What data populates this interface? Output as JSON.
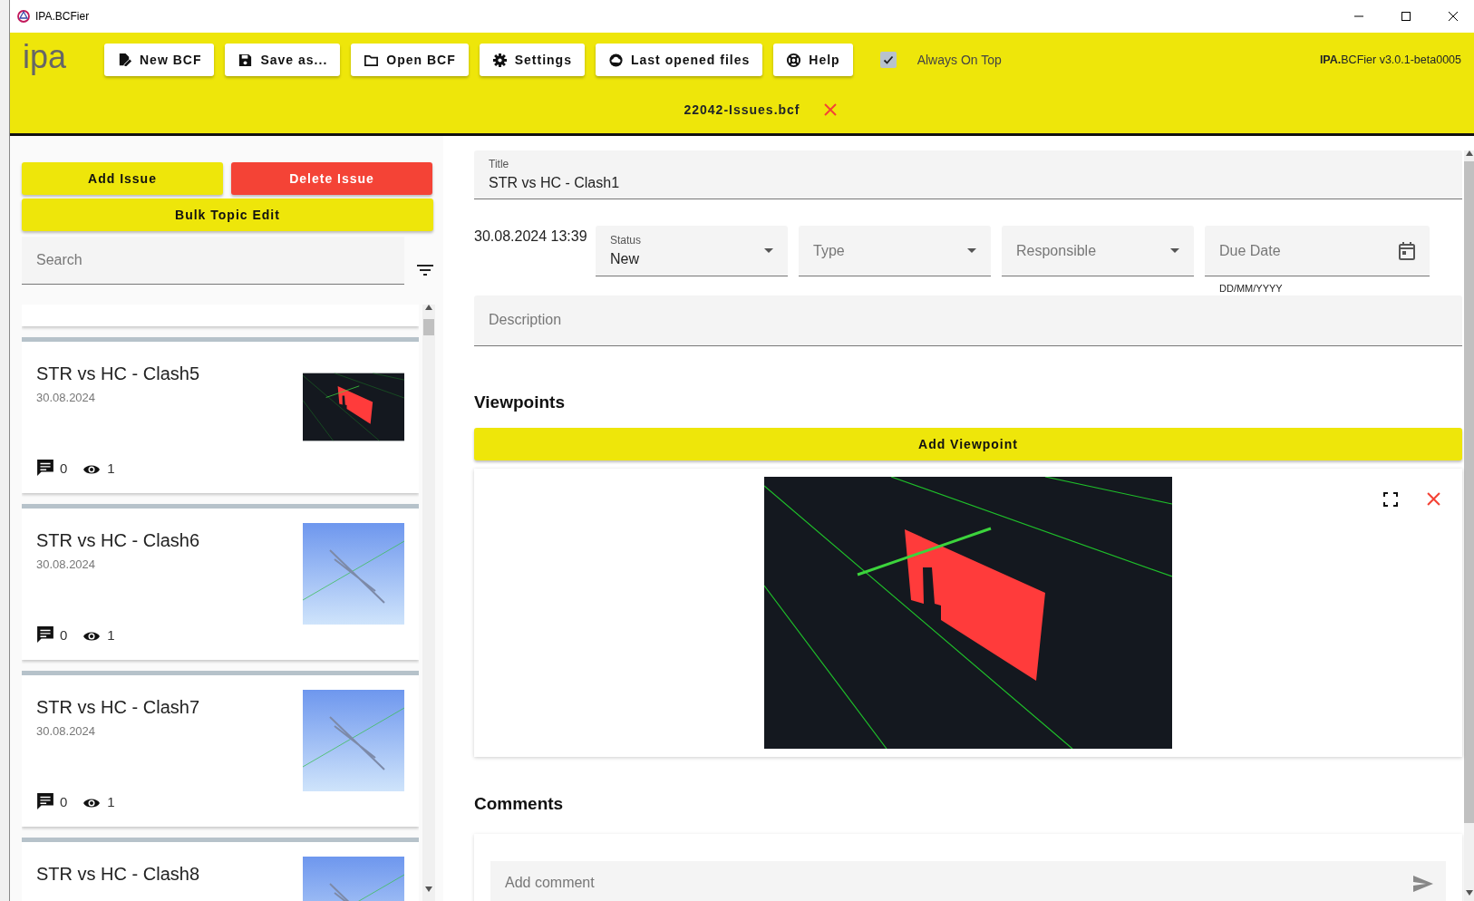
{
  "window": {
    "title": "IPA.BCFier"
  },
  "header": {
    "logo": "ipa",
    "buttons": [
      {
        "label": "New BCF"
      },
      {
        "label": "Save as..."
      },
      {
        "label": "Open BCF"
      },
      {
        "label": "Settings"
      },
      {
        "label": "Last opened files"
      },
      {
        "label": "Help"
      }
    ],
    "always_on_top": {
      "label": "Always On Top",
      "checked": true
    },
    "version": "**IPA.**BCFier v3.0.1-beta0005",
    "open_file": "22042-Issues.bcf"
  },
  "issue_actions": [
    {
      "label": "Add Issue",
      "kind": "add"
    },
    {
      "label": "Delete Issue",
      "kind": "delete"
    },
    {
      "label": "Bulk Topic Edit",
      "kind": "bulk"
    }
  ],
  "search": {
    "placeholder": "Search"
  },
  "issues": [
    {
      "title": "STR vs HC - Clash5",
      "date": "30.08.2024",
      "comments": "0",
      "viewpoints": "1",
      "kind": "dark"
    },
    {
      "title": "STR vs HC - Clash6",
      "date": "30.08.2024",
      "comments": "0",
      "viewpoints": "1",
      "kind": "blue"
    },
    {
      "title": "STR vs HC - Clash7",
      "date": "30.08.2024",
      "comments": "0",
      "viewpoints": "1",
      "kind": "blue"
    },
    {
      "title": "STR vs HC - Clash8",
      "kind": "blue"
    }
  ],
  "detail": {
    "title_label": "Title",
    "title": "STR vs HC - Clash1",
    "created": "30.08.2024 13:39",
    "fields": [
      {
        "kind": "select",
        "label": "Status",
        "value": "New"
      },
      {
        "kind": "select",
        "label": "Type"
      },
      {
        "kind": "select",
        "label": "Responsible"
      },
      {
        "kind": "date",
        "label": "Due Date",
        "hint": "DD/MM/YYYY"
      }
    ],
    "description": {
      "placeholder": "Description"
    },
    "viewpoints_heading": "Viewpoints",
    "add_viewpoint": "Add Viewpoint",
    "comments_heading": "Comments",
    "comment": {
      "placeholder": "Add comment"
    }
  }
}
